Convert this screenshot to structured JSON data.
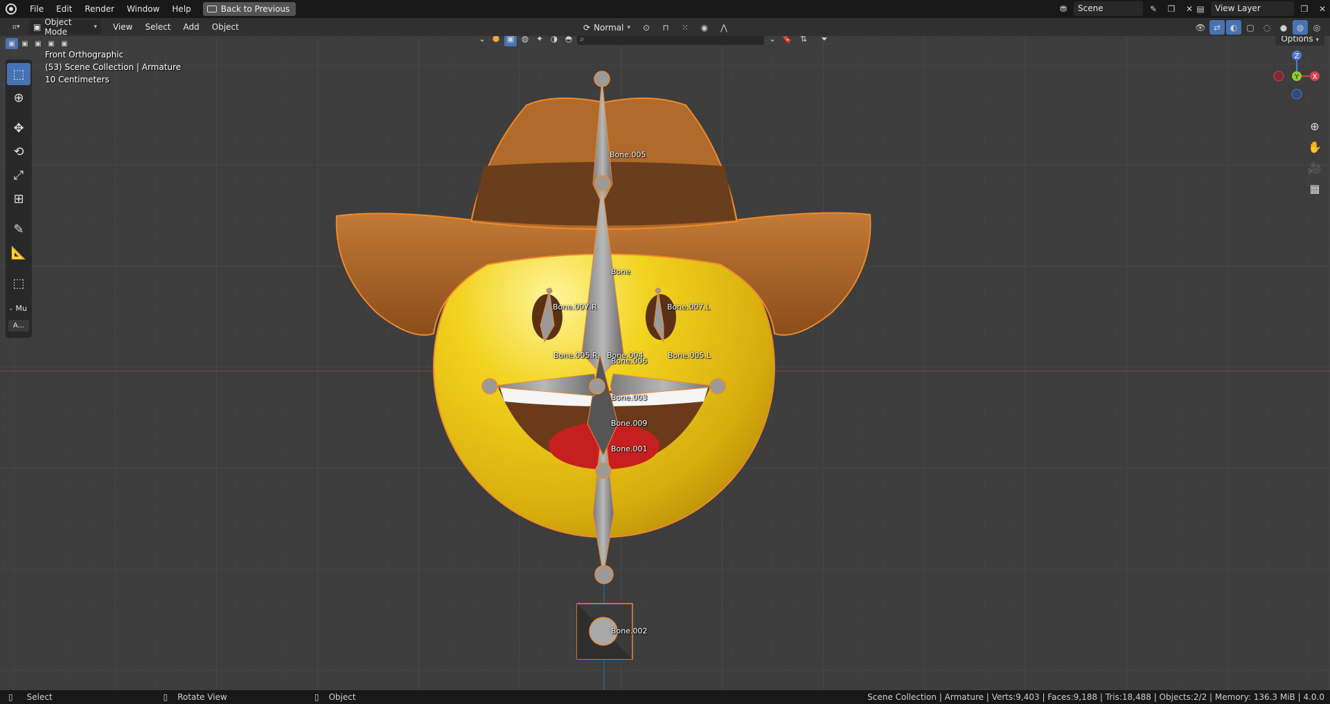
{
  "topbar": {
    "menus": [
      "File",
      "Edit",
      "Render",
      "Window",
      "Help"
    ],
    "back_button": "Back to Previous",
    "scene": "Scene",
    "view_layer": "View Layer"
  },
  "header": {
    "mode": "Object Mode",
    "menus": [
      "View",
      "Select",
      "Add",
      "Object"
    ],
    "orientation": "Normal",
    "options": "Options"
  },
  "toolbar": {
    "collapsed_label": "Mu",
    "asset_label": "A..."
  },
  "viewport": {
    "view_name": "Front Orthographic",
    "collection": "(53) Scene Collection | Armature",
    "scale": "10 Centimeters",
    "gizmo": {
      "z": "Z",
      "y": "Y",
      "x": "X"
    }
  },
  "bones": {
    "b005": "Bone.005",
    "bone": "Bone",
    "b007r": "Bone.007.R",
    "b007l": "Bone.007.L",
    "b005r": "Bone.005.R",
    "b004": "Bone.004",
    "b005l": "Bone.005.L",
    "b006": "Bone.006",
    "b003": "Bone.003",
    "b009": "Bone.009",
    "b001": "Bone.001",
    "b002": "Bone.002"
  },
  "statusbar": {
    "select": "Select",
    "rotate": "Rotate View",
    "object": "Object",
    "stats": "Scene Collection | Armature | Verts:9,403 | Faces:9,188 | Tris:18,488 | Objects:2/2 | Memory: 136.3 MiB | 4.0.0"
  },
  "colors": {
    "accent": "#4772b3",
    "selection": "#f0892c",
    "face": "#e6c31a",
    "hat": "#a15f26"
  }
}
